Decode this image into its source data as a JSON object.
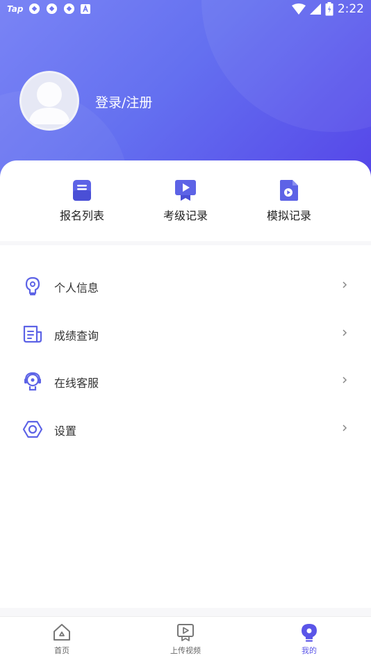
{
  "status_bar": {
    "app_label": "Tap",
    "time": "2:22",
    "icons": [
      "tap-icon",
      "sync-icon",
      "sync-icon",
      "sync-icon",
      "a-icon",
      "wifi-icon",
      "signal-icon",
      "battery-icon"
    ]
  },
  "profile": {
    "login_label": "登录/注册"
  },
  "quick_actions": [
    {
      "label": "报名列表",
      "icon": "register-list-icon"
    },
    {
      "label": "考级记录",
      "icon": "exam-record-icon"
    },
    {
      "label": "模拟记录",
      "icon": "mock-record-icon"
    }
  ],
  "menu": [
    {
      "label": "个人信息",
      "icon": "personal-info-icon"
    },
    {
      "label": "成绩查询",
      "icon": "score-query-icon"
    },
    {
      "label": "在线客服",
      "icon": "customer-service-icon"
    },
    {
      "label": "设置",
      "icon": "settings-icon"
    }
  ],
  "tabbar": [
    {
      "label": "首页",
      "icon": "home-icon",
      "active": false
    },
    {
      "label": "上传视频",
      "icon": "upload-video-icon",
      "active": false
    },
    {
      "label": "我的",
      "icon": "profile-icon",
      "active": true
    }
  ],
  "colors": {
    "accent": "#5a55e8",
    "header_start": "#7a84f5",
    "header_end": "#5545e8",
    "icon_outline": "#5d63e6"
  }
}
